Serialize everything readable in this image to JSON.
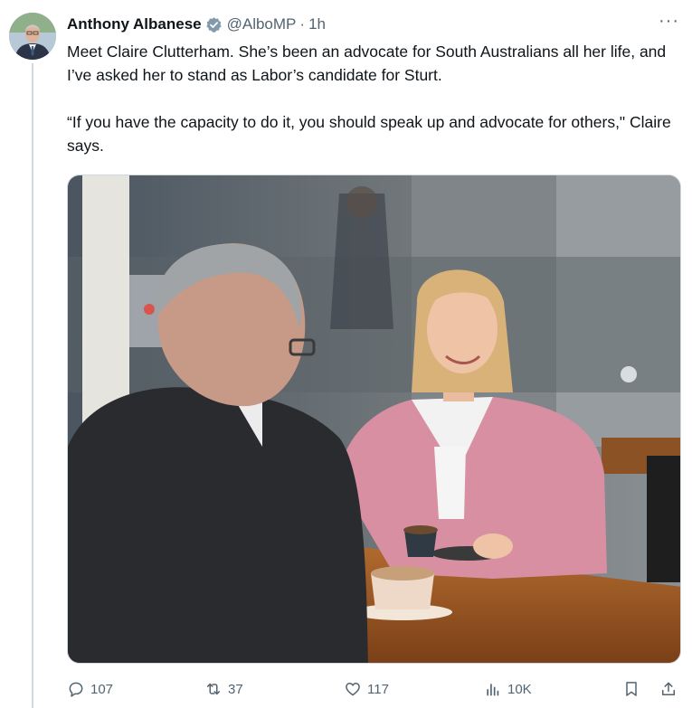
{
  "author": {
    "name": "Anthony Albanese",
    "handle": "@AlboMP",
    "separator": "·",
    "time": "1h"
  },
  "tweet": {
    "paragraph1": "Meet Claire Clutterham. She’s been an advocate for South Australians all her life, and I’ve asked her to stand as Labor’s candidate for Sturt.",
    "paragraph2": "“If you have the capacity to do it, you should speak up and advocate for others,\" Claire says."
  },
  "more_label": "···",
  "actions": {
    "replies": "107",
    "reposts": "37",
    "likes": "117",
    "views": "10K"
  },
  "colors": {
    "secondary_text": "#536471",
    "verified_badge": "#829aab",
    "thread_line": "#cfd9de"
  }
}
